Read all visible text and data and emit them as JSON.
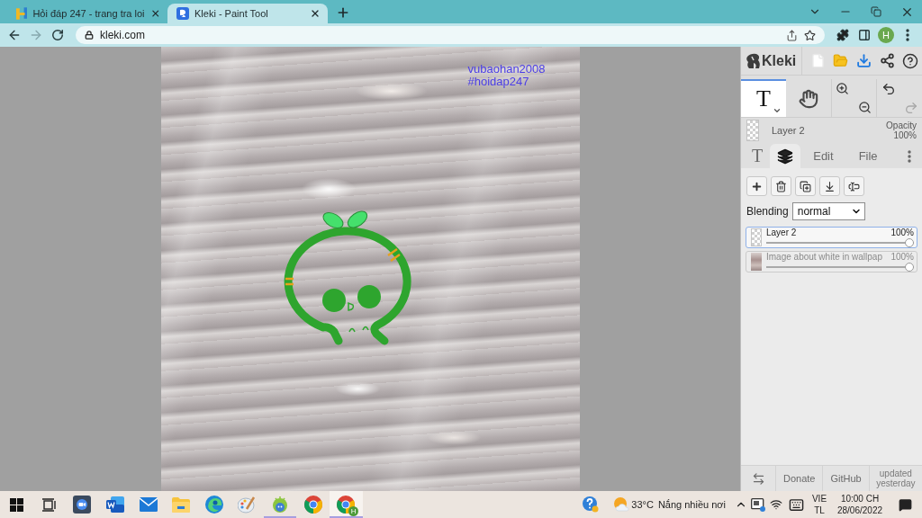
{
  "browser": {
    "tabs": [
      {
        "title": "Hỏi đáp 247 - trang tra loi",
        "kind": "hoidap",
        "selected": false
      },
      {
        "title": "Kleki - Paint Tool",
        "kind": "kleki",
        "selected": true
      }
    ],
    "nav": [
      {
        "kind": "back",
        "disabled": false
      },
      {
        "kind": "forward",
        "disabled": true
      },
      {
        "kind": "reload",
        "disabled": false
      }
    ],
    "address_bar": {
      "url": "kleki.com"
    },
    "profile": {
      "initial": "H"
    }
  },
  "canvas": {
    "texts": [
      "vubaohan2008",
      "#hoidap247"
    ]
  },
  "panel": {
    "brand": "Kleki",
    "tools": [
      {
        "kind": "text",
        "glyph": "T",
        "selected": true
      },
      {
        "kind": "hand",
        "selected": false
      }
    ],
    "history": [
      {
        "kind": "undo",
        "disabled": false
      },
      {
        "kind": "redo",
        "disabled": true
      }
    ],
    "current_layer": {
      "name": "Layer 2",
      "opacity_label": "Opacity",
      "opacity": "100%"
    },
    "tabs": [
      {
        "kind": "glyph",
        "label": "T",
        "selected": false
      },
      {
        "kind": "layers",
        "selected": true
      },
      {
        "kind": "text",
        "label": "Edit",
        "selected": false
      },
      {
        "kind": "text",
        "label": "File",
        "selected": false
      }
    ],
    "blending": {
      "label": "Blending",
      "value": "normal"
    },
    "layers": [
      {
        "name": "Layer 2",
        "opacity": "100%",
        "level": 1,
        "kind": "drawing",
        "selected": true
      },
      {
        "name": "Image about white in wallpap",
        "opacity": "100%",
        "level": 1,
        "kind": "image",
        "selected": false
      }
    ],
    "footer": {
      "links": [
        "Donate",
        "GitHub"
      ],
      "note": "updated yesterday"
    }
  },
  "taskbar": {
    "apps": [
      {
        "kind": "video",
        "running": false,
        "selected": false
      },
      {
        "kind": "word",
        "running": false,
        "selected": false
      },
      {
        "kind": "mail",
        "running": false,
        "selected": false
      },
      {
        "kind": "folder",
        "running": false,
        "selected": false
      },
      {
        "kind": "edge",
        "running": false,
        "selected": false
      },
      {
        "kind": "paint",
        "running": false,
        "selected": false
      },
      {
        "kind": "greenapp",
        "running": true,
        "selected": false
      },
      {
        "kind": "chrome",
        "running": false,
        "selected": false
      },
      {
        "kind": "chromeprofile",
        "badge": "H",
        "running": true,
        "selected": true
      }
    ],
    "tray": {
      "temperature": "33°C",
      "weather": "Nắng nhiều nơi",
      "language": "VIE",
      "layout": "TL",
      "time": "10:00 CH",
      "date": "28/06/2022"
    }
  }
}
